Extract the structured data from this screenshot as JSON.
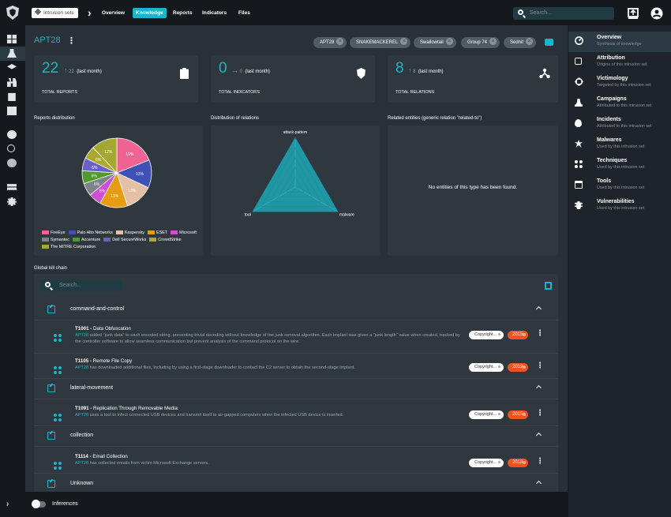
{
  "topbar": {
    "breadcrumb": {
      "entity_type": "Intrusion sets",
      "tabs": [
        "Overview",
        "Knowledge",
        "Reports",
        "Indicators",
        "Files"
      ],
      "active_tab": "Knowledge"
    },
    "search_placeholder": "Search...",
    "icons": [
      "upload-icon",
      "account-icon"
    ]
  },
  "leftnav": {
    "icons": [
      "dashboard-icon",
      "threats-icon",
      "arsenal-icon",
      "techniques-icon",
      "reports-icon",
      "observables-icon",
      "explore-icon",
      "relations-icon",
      "sandbox-icon",
      "data-icon",
      "settings-icon"
    ],
    "selected": "threats-icon"
  },
  "header": {
    "title": "APT28",
    "aliases": [
      "APT28",
      "SNAKEMACKEREL",
      "Swallowtail",
      "Group 74",
      "Sednit"
    ]
  },
  "stats": [
    {
      "value": "22",
      "delta": "22",
      "delta_label": "(last month)",
      "label": "TOTAL REPORTS",
      "icon": "clipboard-icon"
    },
    {
      "value": "0",
      "delta": "0",
      "delta_label": "(last month)",
      "label": "TOTAL INDICATORS",
      "icon": "shield-search-icon"
    },
    {
      "value": "8",
      "delta": "8",
      "delta_label": "(last month)",
      "label": "TOTAL RELATIONS",
      "icon": "graph-icon"
    }
  ],
  "sections": {
    "reports_distribution": "Reports distribution",
    "distribution_relations": "Distribution of relations",
    "related_entities": "Related entities (generic relation \"related-to\")",
    "related_empty": "No entities of this type has been found.",
    "kill_chain": "Global kill chain"
  },
  "chart_data": [
    {
      "type": "pie",
      "title": "Reports distribution",
      "categories": [
        "FireEye",
        "Palo Alto Networks",
        "Kaspersky",
        "ESET",
        "Microsoft",
        "Symantec",
        "Accenture",
        "Dell SecureWorks",
        "CrowdStrike",
        "The MITRE Corporation"
      ],
      "values": [
        19,
        13,
        13,
        13,
        6,
        6,
        6,
        6,
        6,
        12
      ],
      "labels": [
        "19%",
        "13%",
        "13%",
        "13%",
        "6%",
        "6%",
        "6%",
        "6%",
        "6%",
        "12%"
      ],
      "colors": [
        "#f06292",
        "#3f51b5",
        "#e6c0a6",
        "#e69d14",
        "#cf4fd4",
        "#7d8388",
        "#4e9a2a",
        "#6d5fc9",
        "#aaa82d",
        "#a3a832"
      ]
    },
    {
      "type": "radar",
      "title": "Distribution of relations",
      "categories": [
        "attack-pattern",
        "malware",
        "tool"
      ],
      "values": [
        8,
        8,
        8
      ]
    }
  ],
  "killchain": {
    "search_placeholder": "Search...",
    "phases": [
      {
        "name": "command-and-control",
        "items": [
          {
            "id": "T1001",
            "name": "Data Obfuscation",
            "actor": "APT28",
            "description": " added \"junk data\" to each encoded string, preventing trivial decoding without knowledge of the junk removal algorithm. Each implant was given a \"junk length\" value when created, tracked by the controller software to allow seamless communication but prevent analysis of the command protocol on the wire.",
            "marking": "Copyright...",
            "year": "2015"
          },
          {
            "id": "T1105",
            "name": "Remote File Copy",
            "actor": "APT28",
            "description": " has downloaded additional files, including by using a first-stage downloader to contact the C2 server to obtain the second-stage implant.",
            "marking": "Copyright...",
            "year": "2019"
          }
        ]
      },
      {
        "name": "lateral-movement",
        "items": [
          {
            "id": "T1091",
            "name": "Replication Through Removable Media",
            "actor": "APT28",
            "description": " uses a tool to infect connected USB devices and transmit itself to air-gapped computers when the infected USB device is inserted.",
            "marking": "Copyright...",
            "year": "2015"
          }
        ]
      },
      {
        "name": "collection",
        "items": [
          {
            "id": "T1114",
            "name": "Email Collection",
            "actor": "APT28",
            "description": " has collected emails from victim Microsoft Exchange servers.",
            "marking": "Copyright...",
            "year": "2018"
          }
        ]
      },
      {
        "name": "Unknown",
        "items": []
      }
    ]
  },
  "rightmenu": [
    {
      "title": "Overview",
      "subtitle": "Synthesis of knowledge",
      "icon": "gauge-icon",
      "selected": true
    },
    {
      "title": "Attribution",
      "subtitle": "Origins of this intrusion set",
      "icon": "attribution-icon"
    },
    {
      "title": "Victimology",
      "subtitle": "Targeted by this intrusion set",
      "icon": "target-icon"
    },
    {
      "title": "Campaigns",
      "subtitle": "Attributed to this intrusion set",
      "icon": "chess-icon"
    },
    {
      "title": "Incidents",
      "subtitle": "Attributed to this intrusion set",
      "icon": "fire-icon"
    },
    {
      "title": "Malwares",
      "subtitle": "Used by this intrusion set",
      "icon": "biohazard-icon"
    },
    {
      "title": "Techniques",
      "subtitle": "Used by this intrusion set",
      "icon": "techniques-icon"
    },
    {
      "title": "Tools",
      "subtitle": "Used by this intrusion set",
      "icon": "window-icon"
    },
    {
      "title": "Vulnerabilities",
      "subtitle": "Used by this intrusion set",
      "icon": "bug-icon"
    }
  ],
  "bottom": {
    "toggle_label": "Inferences",
    "toggle_on": false
  }
}
